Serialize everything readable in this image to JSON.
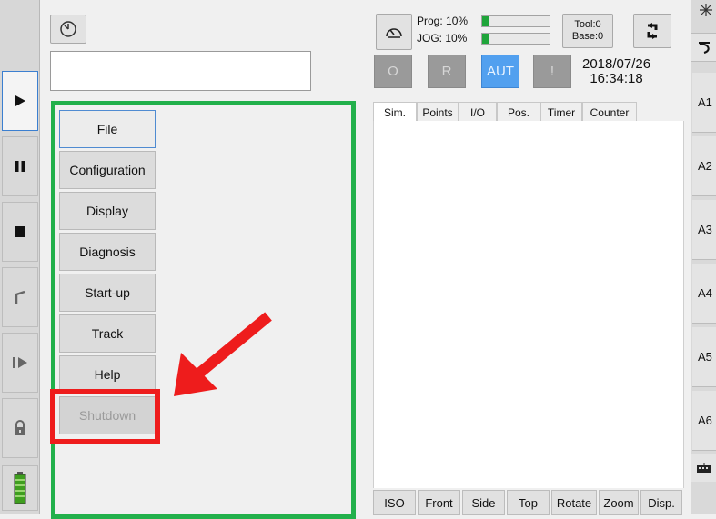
{
  "header": {
    "prog_label": "Prog: 10%",
    "jog_label": "JOG: 10%",
    "prog_pct": 0.1,
    "jog_pct": 0.1,
    "tool_label": "Tool:0",
    "base_label": "Base:0",
    "date": "2018/07/26",
    "time": "16:34:18",
    "modes": [
      "O",
      "R",
      "AUT",
      "!"
    ],
    "active_mode": "AUT",
    "status_text": ""
  },
  "menu": {
    "items": [
      "File",
      "Configuration",
      "Display",
      "Diagnosis",
      "Start-up",
      "Track",
      "Help",
      "Shutdown"
    ],
    "selected": "File",
    "disabled": "Shutdown"
  },
  "tabs": [
    "Sim.",
    "Points",
    "I/O",
    "Pos.",
    "Timer",
    "Counter"
  ],
  "active_tab": "Sim.",
  "view_buttons": [
    "ISO",
    "Front",
    "Side",
    "Top",
    "Rotate",
    "Zoom",
    "Disp."
  ],
  "axes": [
    "A1",
    "A2",
    "A3",
    "A4",
    "A5",
    "A6"
  ],
  "icons": {
    "left": [
      "play-icon",
      "pause-icon",
      "stop-icon",
      "robot-arm-icon",
      "step-icon",
      "lock-icon",
      "battery-icon"
    ],
    "top": [
      "clock-icon",
      "gauge-icon",
      "swap-icon"
    ],
    "right": [
      "sparkle-icon",
      "rotation-icon",
      "keyboard-icon"
    ]
  },
  "colors": {
    "highlight_frame": "#22b04b",
    "annotation": "#ee1c1c",
    "active_mode": "#52a0ef",
    "progress": "#1fa53a"
  }
}
